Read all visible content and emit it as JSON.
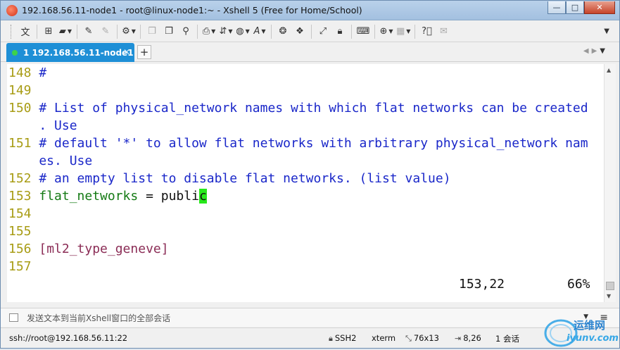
{
  "window": {
    "title": "192.168.56.11-node1 - root@linux-node1:~ - Xshell 5 (Free for Home/School)",
    "controls": {
      "minimize": "—",
      "maximize": "□",
      "close": "✕"
    }
  },
  "toolbar": {
    "language_label": "文",
    "icons": [
      "new-session-icon",
      "open-folder-icon",
      "edit-icon",
      "reconnect-icon",
      "properties-icon",
      "copy-icon",
      "paste-icon",
      "find-icon",
      "print-icon",
      "transfer-icon",
      "globe-icon",
      "font-icon",
      "xftp-icon",
      "xagent-icon",
      "fullscreen-icon",
      "lock-icon",
      "keyboard-icon",
      "add-pane-icon",
      "layout-icon",
      "help-icon",
      "chat-icon"
    ]
  },
  "tabs": [
    {
      "label": "1 192.168.56.11-node1",
      "close": "✕",
      "active": true
    }
  ],
  "tab_add": "+",
  "terminal": {
    "lines": [
      {
        "num": "148",
        "text": " #",
        "kind": "comment"
      },
      {
        "num": "149",
        "text": "",
        "kind": "comment"
      },
      {
        "num": "150",
        "text": " # List of physical_network names with which flat networks can be created",
        "kind": "comment"
      },
      {
        "num": "",
        "text": "    . Use",
        "kind": "comment"
      },
      {
        "num": "151",
        "text": " # default '*' to allow flat networks with arbitrary physical_network nam",
        "kind": "comment"
      },
      {
        "num": "",
        "text": "    es. Use",
        "kind": "comment"
      },
      {
        "num": "152",
        "text": " # an empty list to disable flat networks. (list value)",
        "kind": "comment"
      },
      {
        "num": "153",
        "key": " flat_networks",
        "rest": " = publi",
        "cursor_char": "c",
        "kind": "setting"
      },
      {
        "num": "154",
        "text": "",
        "kind": "comment"
      },
      {
        "num": "155",
        "text": "",
        "kind": "comment"
      },
      {
        "num": "156",
        "text": " [ml2_type_geneve]",
        "kind": "section"
      },
      {
        "num": "157",
        "text": "",
        "kind": "comment"
      }
    ],
    "cursor_position": "153,22",
    "scroll_percent": "66%"
  },
  "compose": {
    "placeholder": "发送文本到当前Xshell窗口的全部会话"
  },
  "statusbar": {
    "connection": "ssh://root@192.168.56.11:22",
    "protocol": "SSH2",
    "terminal_type": "xterm",
    "size": "76x13",
    "cursor": "8,26",
    "sessions": "1 会话"
  },
  "watermark": {
    "line1": "运维网",
    "line2": "iyunv.com"
  },
  "colors": {
    "line_number": "#a89c15",
    "comment": "#1a27c9",
    "setting_key": "#147a14",
    "section": "#8b2d56",
    "cursor": "#27e81b",
    "tab_active": "#1e8fd6"
  }
}
